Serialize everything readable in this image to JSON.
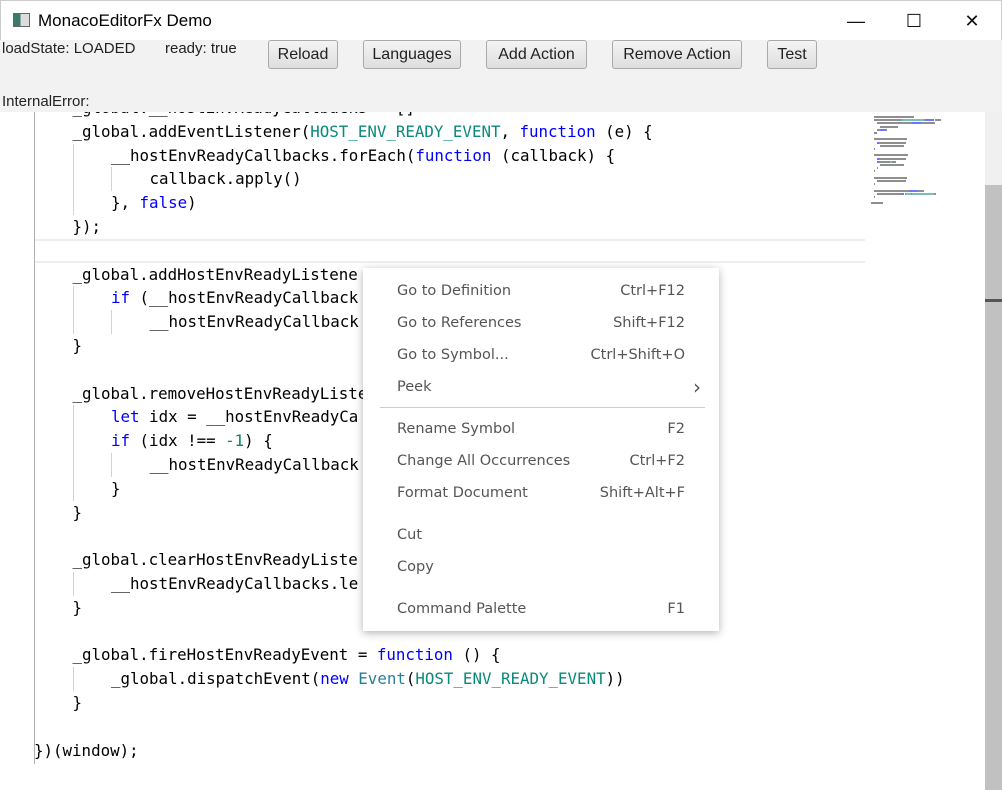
{
  "window": {
    "title": "MonacoEditorFx Demo",
    "minimize": "—",
    "maximize": "☐",
    "close": "✕"
  },
  "toolbar": {
    "load_state": "loadState: LOADED",
    "ready": "ready: true",
    "internal_error": "InternalError:",
    "buttons": [
      "Reload",
      "Languages",
      "Add Action",
      "Remove Action",
      "Test"
    ]
  },
  "code": [
    {
      "i": 1,
      "t": [
        [
          "_global.__hostEnvReadyCallbacks = []",
          ""
        ]
      ]
    },
    {
      "i": 1,
      "t": [
        [
          "_global.addEventListener(",
          ""
        ],
        [
          "HOST_ENV_READY_EVENT",
          "cn"
        ],
        [
          ", ",
          ""
        ],
        [
          "function",
          "kw"
        ],
        [
          " (e) {",
          ""
        ]
      ]
    },
    {
      "i": 2,
      "t": [
        [
          "__hostEnvReadyCallbacks.forEach(",
          ""
        ],
        [
          "function",
          "kw"
        ],
        [
          " (callback) {",
          ""
        ]
      ]
    },
    {
      "i": 3,
      "t": [
        [
          "callback.apply()",
          ""
        ]
      ]
    },
    {
      "i": 2,
      "t": [
        [
          "}, ",
          ""
        ],
        [
          "false",
          "kw"
        ],
        [
          ")",
          ""
        ]
      ]
    },
    {
      "i": 1,
      "t": [
        [
          "});",
          ""
        ]
      ]
    },
    {
      "i": 0,
      "t": []
    },
    {
      "i": 1,
      "t": [
        [
          "_global.addHostEnvReadyListene",
          ""
        ]
      ]
    },
    {
      "i": 2,
      "t": [
        [
          "if",
          "kw"
        ],
        [
          " (__hostEnvReadyCallback",
          ""
        ]
      ]
    },
    {
      "i": 3,
      "t": [
        [
          "__hostEnvReadyCallback",
          ""
        ]
      ]
    },
    {
      "i": 1,
      "t": [
        [
          "}",
          ""
        ]
      ]
    },
    {
      "i": 0,
      "t": []
    },
    {
      "i": 1,
      "t": [
        [
          "_global.removeHostEnvReadyListe",
          ""
        ]
      ]
    },
    {
      "i": 2,
      "t": [
        [
          "let",
          "kw"
        ],
        [
          " idx = __hostEnvReadyCa",
          ""
        ]
      ]
    },
    {
      "i": 2,
      "t": [
        [
          "if",
          "kw"
        ],
        [
          " (idx !== ",
          ""
        ],
        [
          "-1",
          "num"
        ],
        [
          ") {",
          ""
        ]
      ]
    },
    {
      "i": 3,
      "t": [
        [
          "__hostEnvReadyCallback",
          ""
        ]
      ]
    },
    {
      "i": 2,
      "t": [
        [
          "}",
          ""
        ]
      ]
    },
    {
      "i": 1,
      "t": [
        [
          "}",
          ""
        ]
      ]
    },
    {
      "i": 0,
      "t": []
    },
    {
      "i": 1,
      "t": [
        [
          "_global.clearHostEnvReadyListe",
          ""
        ]
      ]
    },
    {
      "i": 2,
      "t": [
        [
          "__hostEnvReadyCallbacks.le",
          ""
        ]
      ]
    },
    {
      "i": 1,
      "t": [
        [
          "}",
          ""
        ]
      ]
    },
    {
      "i": 0,
      "t": []
    },
    {
      "i": 1,
      "t": [
        [
          "_global.fireHostEnvReadyEvent = ",
          ""
        ],
        [
          "function",
          "kw"
        ],
        [
          " () {",
          ""
        ]
      ]
    },
    {
      "i": 2,
      "t": [
        [
          "_global.dispatchEvent(",
          ""
        ],
        [
          "new",
          "kw"
        ],
        [
          " ",
          ""
        ],
        [
          "Event",
          "ty"
        ],
        [
          "(",
          ""
        ],
        [
          "HOST_ENV_READY_EVENT",
          "cn"
        ],
        [
          "))",
          ""
        ]
      ]
    },
    {
      "i": 1,
      "t": [
        [
          "}",
          ""
        ]
      ]
    },
    {
      "i": 0,
      "t": []
    },
    {
      "i": 0,
      "t": [
        [
          "})(window);",
          ""
        ]
      ]
    }
  ],
  "context_menu": {
    "items": [
      {
        "label": "Go to Definition",
        "shortcut": "Ctrl+F12"
      },
      {
        "label": "Go to References",
        "shortcut": "Shift+F12"
      },
      {
        "label": "Go to Symbol...",
        "shortcut": "Ctrl+Shift+O"
      },
      {
        "label": "Peek",
        "shortcut": "›"
      },
      {
        "sep": "line"
      },
      {
        "label": "Rename Symbol",
        "shortcut": "F2"
      },
      {
        "label": "Change All Occurrences",
        "shortcut": "Ctrl+F2"
      },
      {
        "label": "Format Document",
        "shortcut": "Shift+Alt+F"
      },
      {
        "sep": "blank"
      },
      {
        "label": "Cut",
        "shortcut": ""
      },
      {
        "label": "Copy",
        "shortcut": ""
      },
      {
        "sep": "blank"
      },
      {
        "label": "Command Palette",
        "shortcut": "F1"
      }
    ]
  },
  "colors": {
    "keyword": "#0000ff",
    "constant": "#0a8a7a",
    "number": "#098658",
    "type": "#267f99"
  }
}
